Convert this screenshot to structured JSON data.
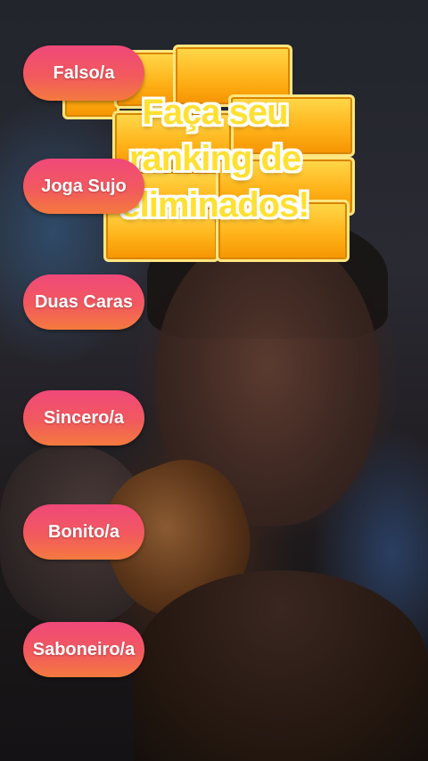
{
  "filter": {
    "title_lines": [
      "Faça seu",
      "ranking de",
      "eliminados!"
    ],
    "options": [
      {
        "label": "Falso/a"
      },
      {
        "label": "Joga Sujo"
      },
      {
        "label": "Duas Caras"
      },
      {
        "label": "Sincero/a"
      },
      {
        "label": "Bonito/a"
      },
      {
        "label": "Saboneiro/a"
      }
    ]
  },
  "colors": {
    "pill_gradient": [
      "#f0497a",
      "#f47a3e"
    ],
    "sticker_yellow": "#ffd84a",
    "title_text": "#ffe033"
  }
}
